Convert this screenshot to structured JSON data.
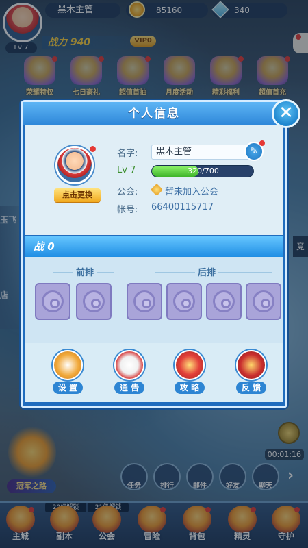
{
  "top": {
    "player_name": "黑木主管",
    "level": "Lv 7",
    "coins": "85160",
    "gems": "340",
    "power": "战力 940",
    "vip": "VIP0"
  },
  "events": [
    {
      "label": "荣耀特权"
    },
    {
      "label": "七日豪礼"
    },
    {
      "label": "超值首抽"
    },
    {
      "label": "月度活动"
    },
    {
      "label": "精彩福利"
    },
    {
      "label": "超值首充"
    }
  ],
  "side": {
    "left_top": "玉飞",
    "left_bottom": "店",
    "right": "竞",
    "timer": "00:01:16",
    "champion_road": "冠军之路"
  },
  "quick": [
    {
      "label": "任务"
    },
    {
      "label": "排行"
    },
    {
      "label": "邮件"
    },
    {
      "label": "好友"
    },
    {
      "label": "聊天"
    }
  ],
  "bottom_nav": {
    "items": [
      {
        "label": "主城"
      },
      {
        "label": "副本"
      },
      {
        "label": "公会"
      },
      {
        "label": "冒险"
      },
      {
        "label": "背包"
      },
      {
        "label": "精灵"
      },
      {
        "label": "守护"
      }
    ],
    "unlock_tags": [
      "20级解锁",
      "21级解锁"
    ]
  },
  "modal": {
    "title": "个人信息",
    "close": "✕",
    "change_avatar": "点击更换",
    "name_label": "名字:",
    "name_value": "黑木主管",
    "edit_icon": "✎",
    "level_label": "Lv 7",
    "xp_text": "320/700",
    "xp_current": 320,
    "xp_max": 700,
    "guild_label": "公会:",
    "guild_value": "暂未加入公会",
    "account_label": "帐号:",
    "account_value": "66400115717",
    "power_strip": "战 0",
    "front_label": "前排",
    "back_label": "后排",
    "functions": [
      {
        "label": "设 置",
        "icon": "gear-clock-icon",
        "color": "#f1a93b"
      },
      {
        "label": "通 告",
        "icon": "megaphone-icon",
        "color": "#f2f2f2"
      },
      {
        "label": "攻 略",
        "icon": "book-icon",
        "color": "#e2403a"
      },
      {
        "label": "反 馈",
        "icon": "scroll-icon",
        "color": "#c92f2f"
      }
    ]
  }
}
